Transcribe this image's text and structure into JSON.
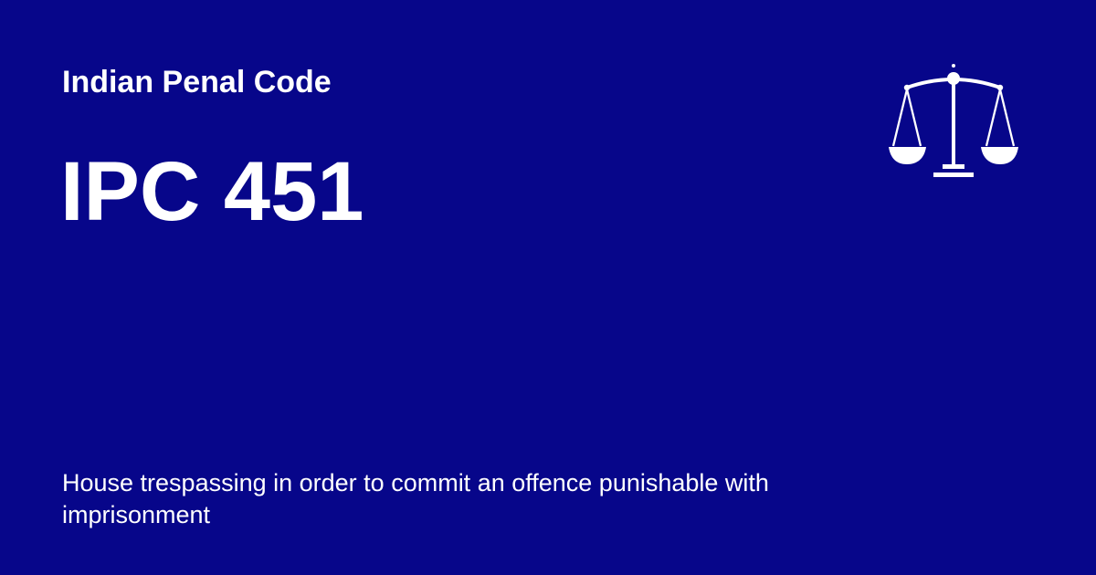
{
  "header": {
    "category": "Indian Penal Code"
  },
  "main": {
    "title": "IPC 451",
    "description": "House trespassing in order to commit an offence punishable with imprisonment"
  },
  "icons": {
    "brand": "scales-of-justice-icon"
  },
  "colors": {
    "background": "#07068a",
    "text": "#ffffff"
  }
}
